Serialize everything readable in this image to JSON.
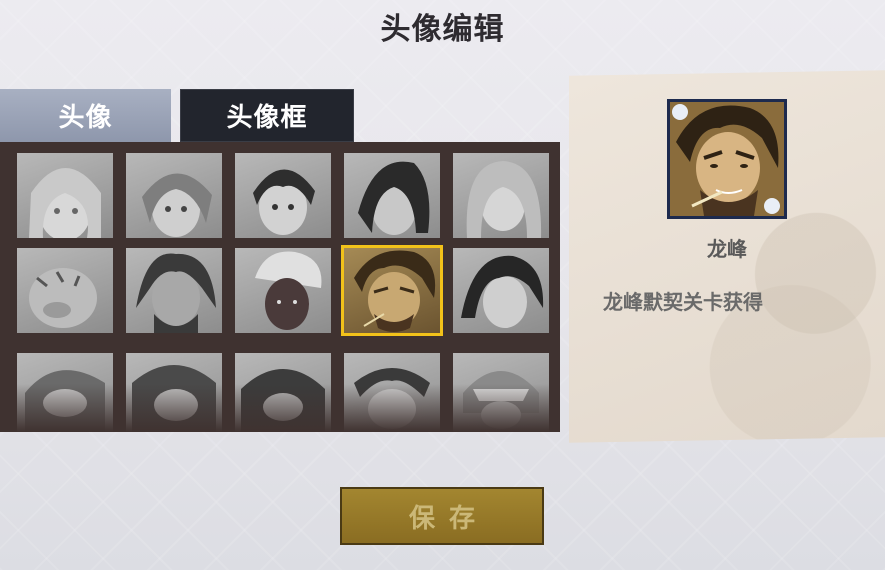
{
  "title": "头像编辑",
  "tabs": {
    "avatar_label": "头像",
    "frame_label": "头像框",
    "active": "头像框"
  },
  "grid": {
    "cells": [
      {
        "name": "portrait-1"
      },
      {
        "name": "portrait-2"
      },
      {
        "name": "portrait-3"
      },
      {
        "name": "portrait-4"
      },
      {
        "name": "portrait-5"
      },
      {
        "name": "portrait-6"
      },
      {
        "name": "portrait-7"
      },
      {
        "name": "portrait-8"
      },
      {
        "name": "portrait-9-longfeng",
        "selected": true
      },
      {
        "name": "portrait-10"
      },
      {
        "name": "portrait-11"
      },
      {
        "name": "portrait-12"
      },
      {
        "name": "portrait-13"
      },
      {
        "name": "portrait-14"
      },
      {
        "name": "portrait-15"
      }
    ]
  },
  "preview": {
    "name": "龙峰",
    "description": "龙峰默契关卡获得"
  },
  "save_button": {
    "label": "保存"
  },
  "colors": {
    "selected_outline": "#f2c21a",
    "save_button": "#9a7c2a",
    "frame_border": "#1d2a4e"
  }
}
